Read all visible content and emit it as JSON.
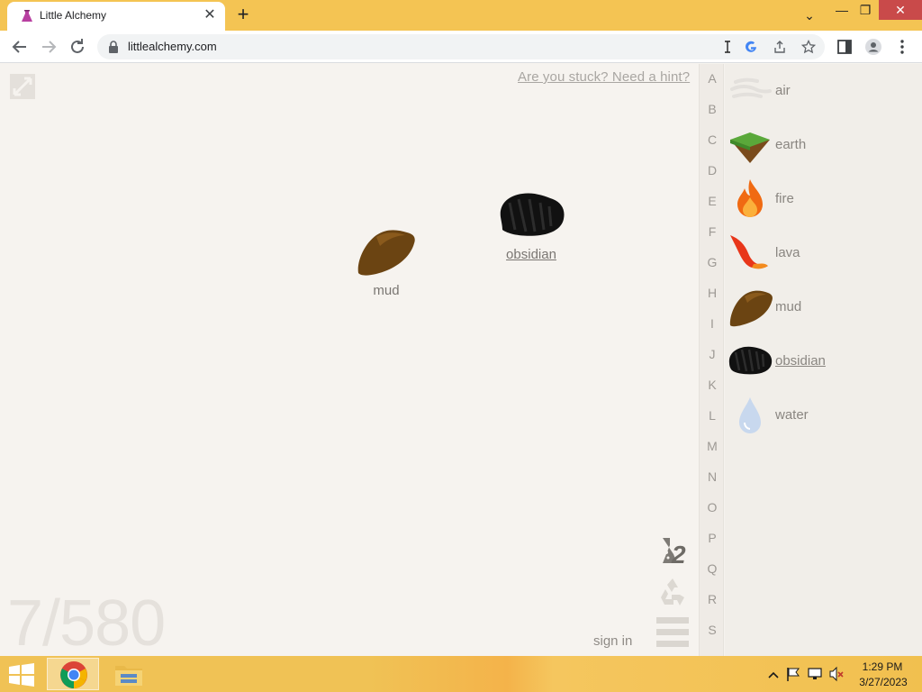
{
  "browser": {
    "tab_title": "Little Alchemy",
    "tab_close": "✕",
    "new_tab": "+",
    "url": "littlealchemy.com",
    "window_controls": {
      "dropdown": "⌄",
      "minimize": "—",
      "maximize": "❐",
      "close": "✕"
    }
  },
  "game": {
    "hint_text": "Are you stuck? Need a hint?",
    "counter": "7/580",
    "sign_in": "sign in",
    "workspace_elements": [
      {
        "name": "mud",
        "icon": "mud-icon",
        "underlined": false
      },
      {
        "name": "obsidian",
        "icon": "obsidian-icon",
        "underlined": true
      }
    ],
    "alphabet": [
      "A",
      "B",
      "C",
      "D",
      "E",
      "F",
      "G",
      "H",
      "I",
      "J",
      "K",
      "L",
      "M",
      "N",
      "O",
      "P",
      "Q",
      "R",
      "S"
    ],
    "elements": [
      {
        "name": "air",
        "icon": "air-icon",
        "underlined": false
      },
      {
        "name": "earth",
        "icon": "earth-icon",
        "underlined": false
      },
      {
        "name": "fire",
        "icon": "fire-icon",
        "underlined": false
      },
      {
        "name": "lava",
        "icon": "lava-icon",
        "underlined": false
      },
      {
        "name": "mud",
        "icon": "mud-icon",
        "underlined": false
      },
      {
        "name": "obsidian",
        "icon": "obsidian-icon",
        "underlined": true
      },
      {
        "name": "water",
        "icon": "water-icon",
        "underlined": false
      }
    ]
  },
  "taskbar": {
    "time": "1:29 PM",
    "date": "3/27/2023"
  }
}
